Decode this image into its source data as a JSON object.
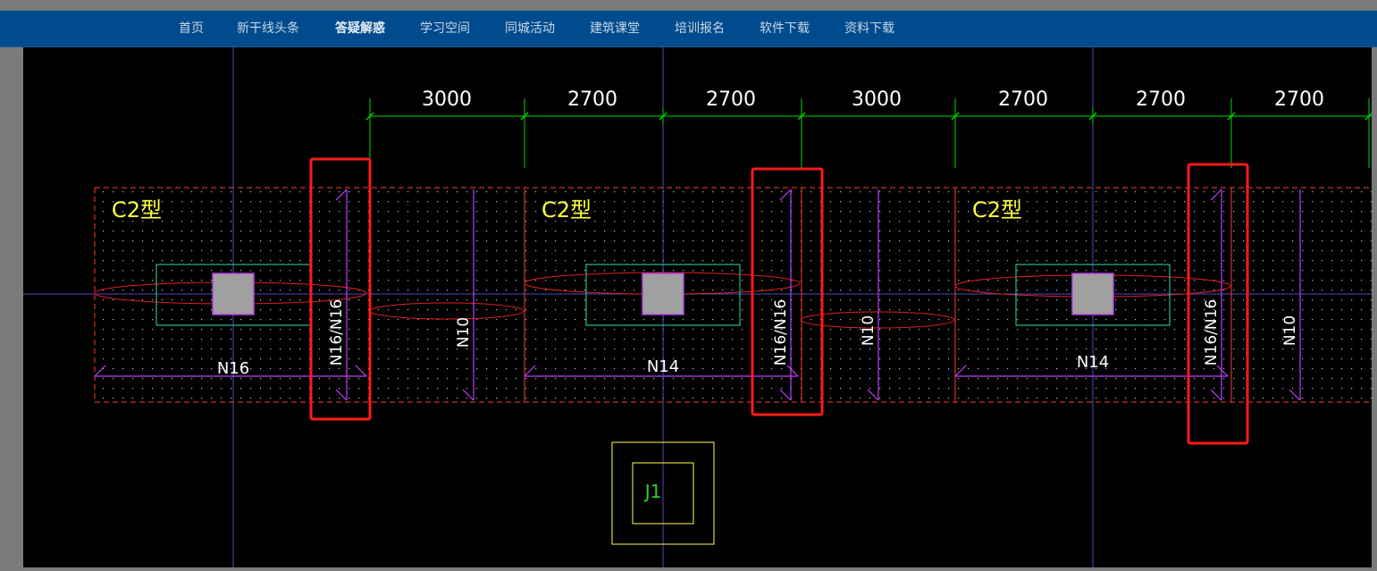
{
  "nav": {
    "items": [
      "首页",
      "新干线头条",
      "答疑解惑",
      "学习空间",
      "同城活动",
      "建筑课堂",
      "培训报名",
      "软件下载",
      "资料下载"
    ],
    "active": "答疑解惑"
  },
  "drawing": {
    "dimensions": [
      "3000",
      "2700",
      "2700",
      "3000",
      "2700",
      "2700",
      "2700"
    ],
    "slab_labels": [
      "C2型",
      "C2型",
      "C2型"
    ],
    "bottom_rebar_labels": [
      "N16",
      "N14",
      "N14"
    ],
    "vertical_rebar_labels": [
      "N16/N16",
      "N10",
      "N16/N16",
      "N10",
      "N16/N16",
      "N10"
    ],
    "footing_label": "J1",
    "colors": {
      "background": "#000000",
      "axis_line": "#5050c8",
      "dimension": "#00e000",
      "slab_outline": "#ff3b2f",
      "rebar": "#c040ff",
      "column": "#a0a0a0",
      "column_outline": "#b040e0",
      "label_yellow": "#ffff40",
      "text_white": "#ffffff",
      "highlight_box": "#ff1a1a",
      "cap_outline": "#40e0a0",
      "footing_outline": "#ffff40",
      "footing_text": "#30d030"
    }
  }
}
